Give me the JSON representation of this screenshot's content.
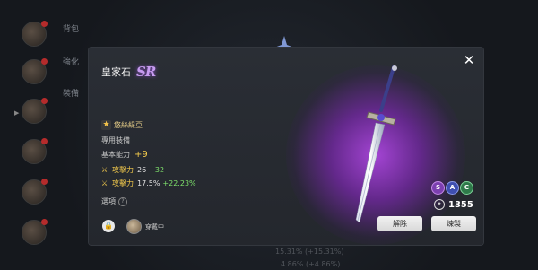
{
  "background": {
    "tabs": [
      "背包",
      "強化",
      "裝備"
    ],
    "stats": [
      "15.31% (+15.31%)",
      "4.86% (+4.86%)"
    ]
  },
  "modal": {
    "title": "皇家石",
    "rarity": "SR",
    "close_label": "✕",
    "owner_icon": "star-icon",
    "owner": "悠絲緹亞",
    "exclusive": "專用裝備",
    "base_label": "基本能力",
    "base_value": "+9",
    "stats": [
      {
        "name": "攻擊力",
        "value": "26",
        "bonus": "+32"
      },
      {
        "name": "攻擊力",
        "value": "17.5%",
        "bonus": "+22.23%"
      }
    ],
    "options_label": "選項",
    "equipped_label": "穿戴中",
    "badges": [
      "S",
      "A",
      "C"
    ],
    "power": "1355",
    "buttons": {
      "dismantle": "解除",
      "refine": "煉製"
    }
  },
  "colors": {
    "accent_gold": "#f2c94c",
    "bonus_green": "#7ee06b",
    "rarity_purple": "#c79bf0",
    "glow_purple": "#aa46dc"
  }
}
